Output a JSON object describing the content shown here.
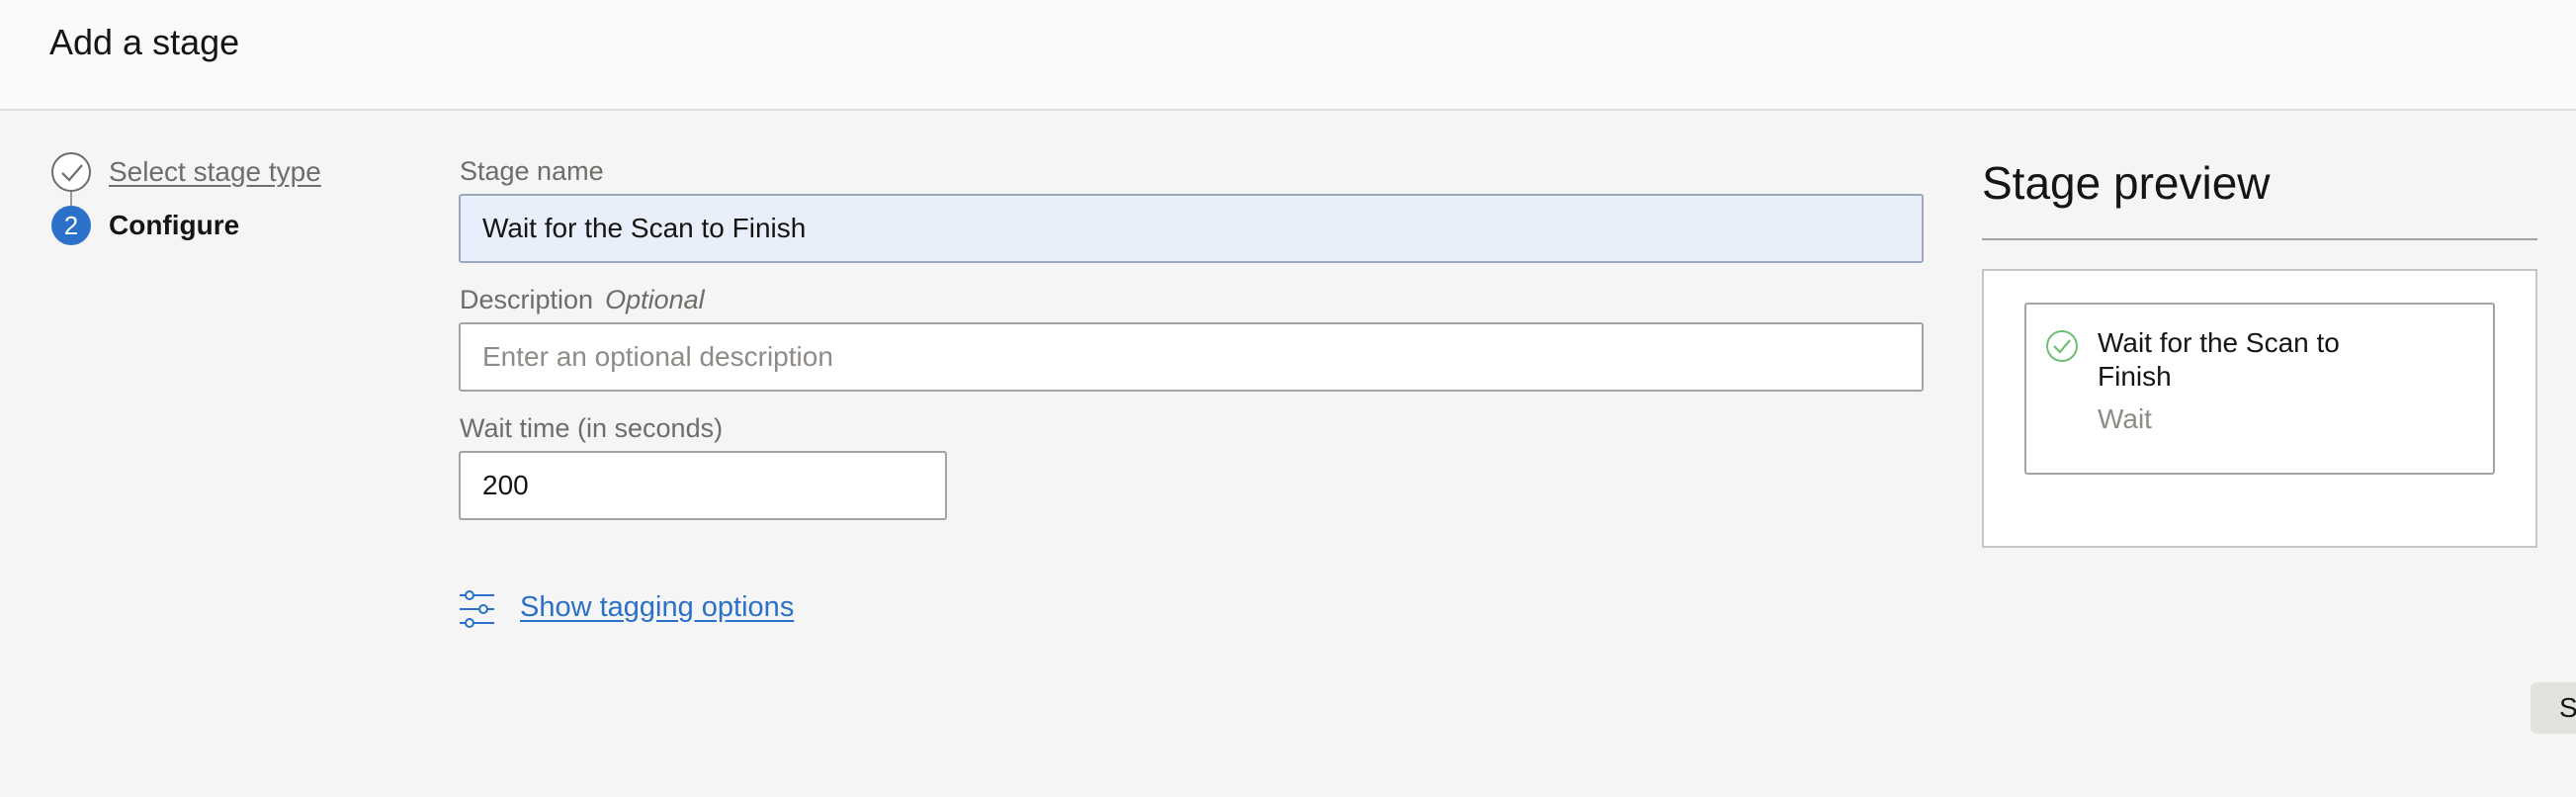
{
  "header": {
    "title": "Add a stage"
  },
  "stepper": {
    "steps": [
      {
        "label": "Select stage type",
        "state": "completed"
      },
      {
        "number": "2",
        "label": "Configure",
        "state": "current"
      }
    ]
  },
  "form": {
    "stage_name": {
      "label": "Stage name",
      "value": "Wait for the Scan to Finish"
    },
    "description": {
      "label": "Description",
      "optional_text": "Optional",
      "placeholder": "Enter an optional description",
      "value": ""
    },
    "wait_time": {
      "label": "Wait time (in seconds)",
      "value": "200"
    },
    "tagging_link": "Show tagging options"
  },
  "preview": {
    "title": "Stage preview",
    "stage": {
      "name": "Wait for the Scan to Finish",
      "type": "Wait",
      "status_icon": "check-circle-icon"
    }
  },
  "footer": {
    "partial_button_label": "S"
  },
  "colors": {
    "accent": "#2c71c9",
    "success": "#6fbf73",
    "focused_field_bg": "#e8effb"
  }
}
